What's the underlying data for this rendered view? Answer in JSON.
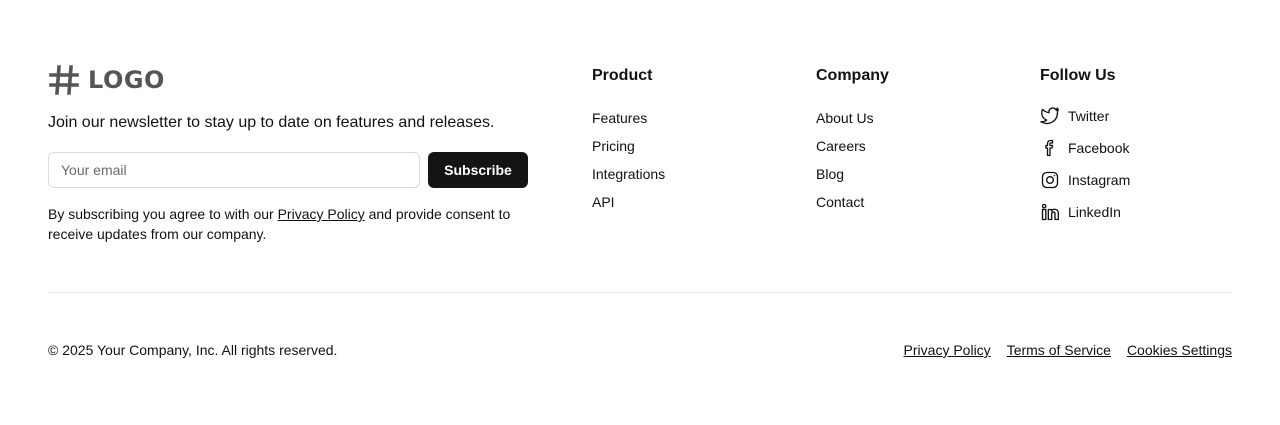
{
  "brand": {
    "logo_text": "LOGO",
    "logo_icon": "hash-icon",
    "newsletter_text": "Join our newsletter to stay up to date on features and releases.",
    "email_placeholder": "Your email",
    "email_value": "",
    "subscribe_label": "Subscribe",
    "consent_before": "By subscribing you agree to with our ",
    "consent_link": "Privacy Policy",
    "consent_after": " and provide consent to receive updates from our company."
  },
  "columns": {
    "product": {
      "title": "Product",
      "items": [
        "Features",
        "Pricing",
        "Integrations",
        "API"
      ]
    },
    "company": {
      "title": "Company",
      "items": [
        "About Us",
        "Careers",
        "Blog",
        "Contact"
      ]
    },
    "follow": {
      "title": "Follow Us",
      "items": [
        {
          "label": "Twitter",
          "icon": "twitter-icon"
        },
        {
          "label": "Facebook",
          "icon": "facebook-icon"
        },
        {
          "label": "Instagram",
          "icon": "instagram-icon"
        },
        {
          "label": "LinkedIn",
          "icon": "linkedin-icon"
        }
      ]
    }
  },
  "bottom": {
    "copyright": "© 2025 Your Company, Inc. All rights reserved.",
    "links": [
      "Privacy Policy",
      "Terms of Service",
      "Cookies Settings"
    ]
  },
  "colors": {
    "text": "#111111",
    "button_bg": "#141414",
    "logo": "#555555",
    "divider": "#e5e5e5"
  }
}
